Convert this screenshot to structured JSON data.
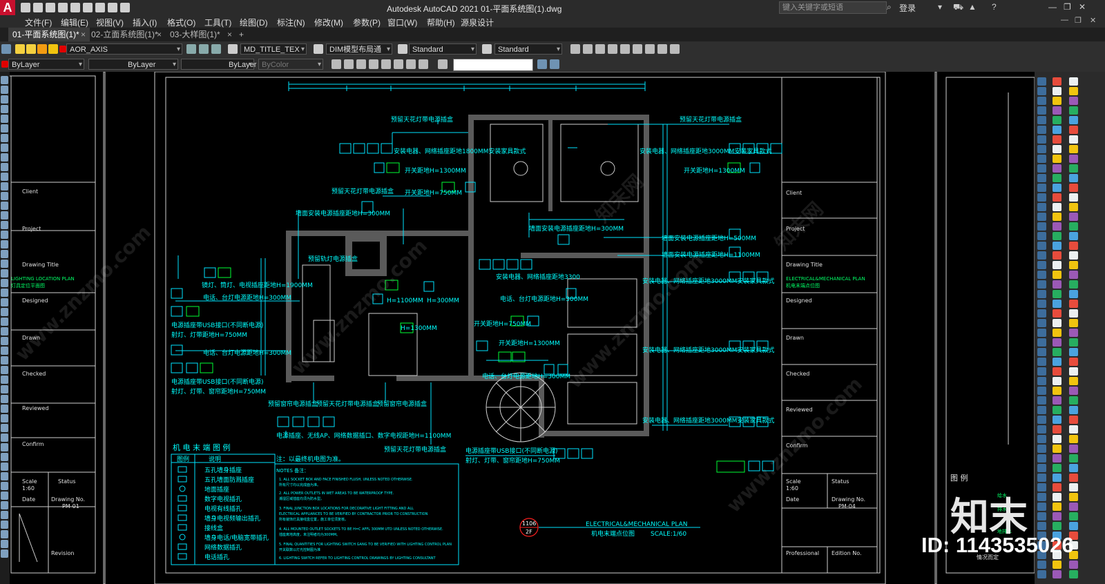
{
  "app": {
    "logo": "A",
    "title": "Autodesk AutoCAD 2021    01-平面系统图(1).dwg",
    "search_placeholder": "键入关键字或短语",
    "login": "登录"
  },
  "menu": [
    "文件(F)",
    "编辑(E)",
    "视图(V)",
    "插入(I)",
    "格式(O)",
    "工具(T)",
    "绘图(D)",
    "标注(N)",
    "修改(M)",
    "参数(P)",
    "窗口(W)",
    "帮助(H)",
    "源泉设计"
  ],
  "tabs": [
    {
      "label": "01-平面系统图(1)*",
      "active": true
    },
    {
      "label": "02-立面系统图(1)*",
      "active": false
    },
    {
      "label": "03-大样图(1)*",
      "active": false
    }
  ],
  "toolbar1": {
    "layer": "AOR_AXIS",
    "text_style": "MD_TITLE_TEX",
    "dim_style": "DIM模型布局通",
    "table_style": "Standard",
    "mleader_style": "Standard",
    "layer_color": "#e00000"
  },
  "toolbar2": {
    "color": "ByLayer",
    "linetype": "ByLayer",
    "lineweight": "ByLayer",
    "plotstyle": "ByColor"
  },
  "drawing": {
    "plan_title": "ELECTRICAL&MECHANICAL PLAN",
    "plan_title_cn": "机电末端点位图",
    "scale": "SCALE:1/60",
    "sheet_no": "1106",
    "floor": "2F",
    "legend_title": "机 电 末 端 图 例",
    "legend_head": [
      "图例",
      "说明"
    ],
    "legend_items": [
      "五孔墙身插座",
      "五孔墙面防溅插座",
      "地面插座",
      "数字电视插孔",
      "电视有线插孔",
      "墙身电视频输出插孔",
      "接线盒",
      "墙身电话/电脑宽带插孔",
      "网络数据插孔",
      "电话插孔"
    ],
    "notes_title": "注：以最终机电图为准。",
    "notes_head": "NOTES 备注：",
    "notes": [
      "1. ALL SOCKET BOX AND FACE FINISHED FLUSH, UNLESS NOTED OTHERWISE.",
      "所有尺寸均以完成面为准。",
      "2. ALL POWER OUTLETS IN WET AREAS TO BE WATERPROOF TYPE.",
      "潮湿区域插座均须为防水型。",
      "3. FINAL JUNCTION BOX LOCATIONS FOR DECORATIVE LIGHT FITTING AND ALL",
      "ELECTRICAL APPLIANCES TO BE VERIFIED BY CONTRACTOR PRIOR TO CONSTRUCTION",
      "所有装饰灯具接线盒位置，施工单位须复核。",
      "4. ALL MOUNTED OUTLET SOCKETS TO BE H=C AFFL 300MM UTD UNLESS NOTED OTHERWISE.",
      "插座离地高度，未注明者均为300MM。",
      "5. FINAL QUANTITIES FOR LIGHTING SWITCH GANG TO BE VERIFIED WITH LIGHTING CONTROL PLAN",
      "开关联数以灯光控制图为准",
      "6. LIGHTING SWITCH REFER TO LIGHTING CONTROL DRAWINGS BY LIGHTING CONSULTANT"
    ],
    "title_block_left": [
      "Client",
      "Project",
      "Drawing Title",
      "LIGHTING LOCATION PLAN",
      "灯具定位平面图",
      "Designed",
      "Drawn",
      "Checked",
      "Reviewed",
      "Scale",
      "1:60",
      "Date",
      "Status",
      "Drawing No.",
      "PM-01",
      "Revision",
      "Confirm"
    ],
    "title_block_right": [
      "Client",
      "Project",
      "Drawing Title",
      "ELECTRICAL&MECHANICAL PLAN",
      "机电末端点位图",
      "Designed",
      "Drawn",
      "Checked",
      "Reviewed",
      "Confirm",
      "Scale",
      "1:60",
      "Status",
      "Date",
      "Drawing No.",
      "PM-04",
      "Professional",
      "Edition No."
    ],
    "annotations": [
      "预留天花灯带电源插盒",
      "预留天花灯带电源插盒",
      "安装电器、网络插座距地1800MM安装家具款式",
      "开关距地H=1300MM",
      "开关距地H=750MM",
      "开关距地H=1300MM",
      "安装电器、网络插座距地3000MM安装家具款式",
      "预留天花灯带电源插盒",
      "墙面安装电源插座距地H=300MM",
      "墙面安装电源插座距地H=300MM",
      "墙面安装电源插座距地H=500MM",
      "墙面安装电源插座距地H=1100MM",
      "预留轨灯电源插盒",
      "镜灯、筒灯、电视插座距地H=1900MM",
      "电话、台灯电源距地H=300MM",
      "电源插座带USB接口(不同断电源)",
      "射灯、灯带距地H=750MM",
      "电话、台灯电源距地H=300MM",
      "电源插座带USB接口(不同断电源)",
      "射灯、灯带、窗帘距地H=750MM",
      "预留窗帘电源插盒",
      "预留天花灯带电源插盒",
      "预留窗帘电源插盒",
      "电源插座、无线AP、网络数据插口、数字电视距地H=1100MM",
      "预留天花灯带电源插盒",
      "电源插座带USB接口(不同断电源)",
      "射灯、灯带、窗帘距地H=750MM",
      "开关距地H=750MM",
      "开关距地H=1300MM",
      "电话、台灯电源距地H=300MM",
      "安装电器、网络插座距地3300",
      "电话、台灯电源距地H=300MM",
      "安装电器、网络插座距地3000MM安装家具款式",
      "安装电器、网络插座距地3000MM安装家具款式",
      "安装电器、网络插座距地3000MM安装家具款式",
      "H=1100MM",
      "H=1300MM",
      "H=300MM"
    ],
    "legend_right_title": "图 例",
    "legend_right_items": [
      "给水",
      "排水",
      "地排水",
      "情况而定"
    ],
    "watermark": "www.znzmo.com",
    "watermark_cn": "知末网"
  },
  "overlay": {
    "brand": "知末",
    "id": "ID: 1143535026"
  }
}
